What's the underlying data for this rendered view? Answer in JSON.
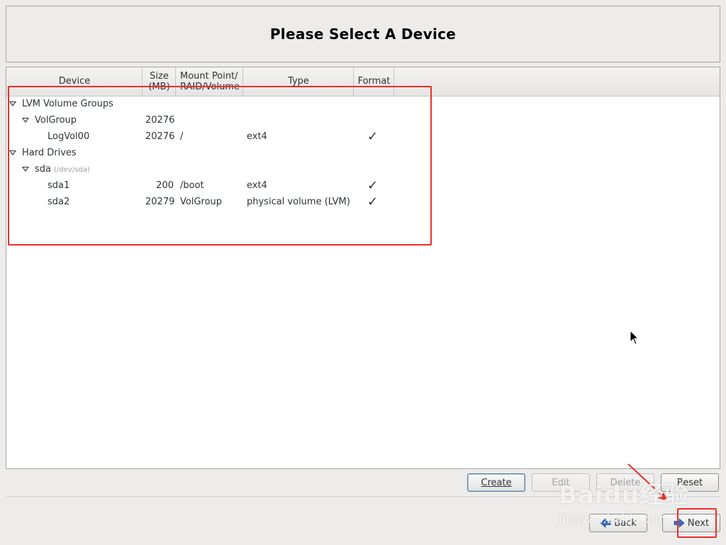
{
  "title": "Please Select A Device",
  "columns": {
    "device": "Device",
    "size": "Size\n(MB)",
    "mount": "Mount Point/\nRAID/Volume",
    "type": "Type",
    "format": "Format"
  },
  "rows": [
    {
      "device": "LVM Volume Groups",
      "size": "",
      "mount": "",
      "type": "",
      "format": false
    },
    {
      "device": "VolGroup",
      "size": "20276",
      "mount": "",
      "type": "",
      "format": false
    },
    {
      "device": "LogVol00",
      "size": "20276",
      "mount": "/",
      "type": "ext4",
      "format": true
    },
    {
      "device": "Hard Drives",
      "size": "",
      "mount": "",
      "type": "",
      "format": false
    },
    {
      "device": "sda",
      "device_path": "(/dev/sda)",
      "size": "",
      "mount": "",
      "type": "",
      "format": false
    },
    {
      "device": "sda1",
      "size": "200",
      "mount": "/boot",
      "type": "ext4",
      "format": true
    },
    {
      "device": "sda2",
      "size": "20279",
      "mount": "VolGroup",
      "type": "physical volume (LVM)",
      "format": true
    }
  ],
  "check_glyph": "✓",
  "actions": {
    "create": "Create",
    "edit": "Edit",
    "delete": "Delete",
    "reset": "Reset"
  },
  "nav": {
    "back": "Back",
    "next": "Next"
  },
  "watermark": {
    "brand": "Baidu经验",
    "url": "jingyan.baidu.com"
  },
  "colors": {
    "highlight_red": "#e8302a",
    "background": "#edeceb",
    "arrow_blue": "#3a6fc4"
  }
}
